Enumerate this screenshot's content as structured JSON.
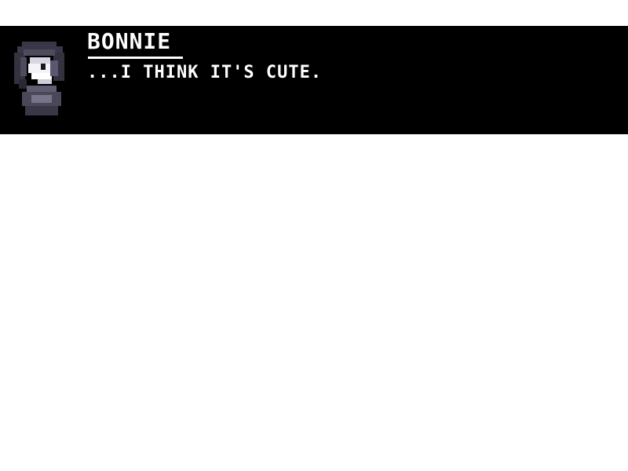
{
  "dialog": {
    "speaker_name": "BONNIE",
    "text": "...I THINK IT'S CUTE.",
    "portrait_icon": "bonnie-portrait-icon"
  },
  "colors": {
    "dialog_background": "#000000",
    "dialog_text": "#ffffff",
    "scene_background": "#ffffff"
  }
}
